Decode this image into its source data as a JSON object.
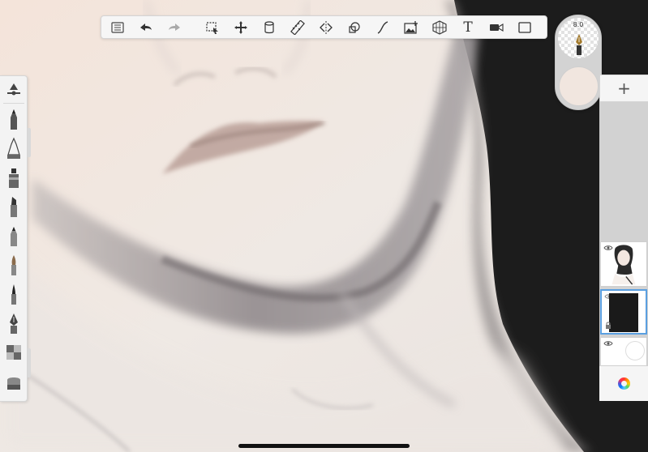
{
  "app": {
    "toolbar": {
      "tools": [
        {
          "icon": "list-icon"
        },
        {
          "icon": "undo-icon"
        },
        {
          "icon": "redo-icon"
        },
        {
          "icon": "selection-icon"
        },
        {
          "icon": "transform-icon"
        },
        {
          "icon": "fill-bucket-icon"
        },
        {
          "icon": "ruler-icon"
        },
        {
          "icon": "symmetry-icon"
        },
        {
          "icon": "shapes-icon"
        },
        {
          "icon": "curve-icon"
        },
        {
          "icon": "add-image-icon"
        },
        {
          "icon": "perspective-grid-icon"
        },
        {
          "icon": "text-icon"
        },
        {
          "icon": "record-video-icon"
        },
        {
          "icon": "fullscreen-icon"
        }
      ],
      "text_tool_glyph": "T"
    },
    "brushes": [
      {
        "icon": "brush-settings-icon"
      },
      {
        "icon": "pencil-icon"
      },
      {
        "icon": "technical-pen-icon"
      },
      {
        "icon": "marker-icon"
      },
      {
        "icon": "chisel-marker-icon"
      },
      {
        "icon": "airbrush-icon"
      },
      {
        "icon": "paintbrush-icon"
      },
      {
        "icon": "fine-brush-icon"
      },
      {
        "icon": "fountain-pen-icon"
      },
      {
        "icon": "gradient-fill-icon"
      },
      {
        "icon": "eraser-icon"
      }
    ],
    "puck": {
      "brush_size": "8.0",
      "current_color": "#f1e6df"
    },
    "layers": {
      "add_glyph": "+",
      "items": [
        {
          "name": "layer-portrait",
          "visible": true,
          "selected": false
        },
        {
          "name": "layer-black",
          "visible": true,
          "selected": true
        },
        {
          "name": "layer-background",
          "visible": true,
          "selected": false
        }
      ]
    },
    "colors": {
      "canvas_skin": "#f1ebe6",
      "hair": "#1c1c1c",
      "selection_accent": "#5a9fe0"
    }
  }
}
